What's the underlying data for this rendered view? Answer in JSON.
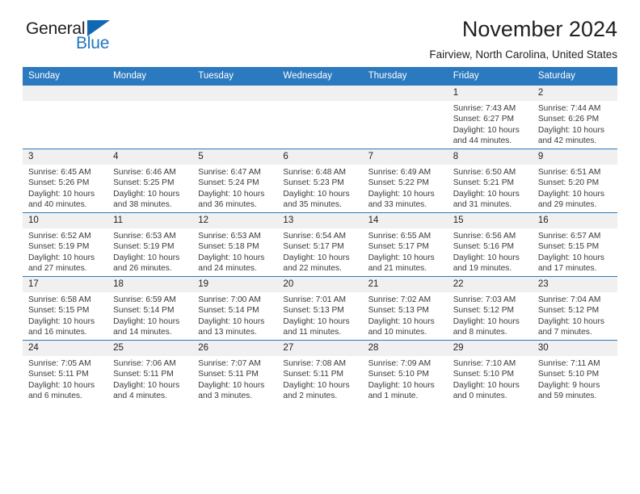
{
  "brand": {
    "name_part1": "General",
    "name_part2": "Blue",
    "triangle_icon": "triangle-icon",
    "accent_color": "#1068b3"
  },
  "header": {
    "month_title": "November 2024",
    "location": "Fairview, North Carolina, United States"
  },
  "calendar": {
    "header_bg": "#2b79bf",
    "daynum_bg": "#f0f0f0",
    "weekdays": [
      "Sunday",
      "Monday",
      "Tuesday",
      "Wednesday",
      "Thursday",
      "Friday",
      "Saturday"
    ],
    "weeks": [
      [
        {
          "day": "",
          "empty": true
        },
        {
          "day": "",
          "empty": true
        },
        {
          "day": "",
          "empty": true
        },
        {
          "day": "",
          "empty": true
        },
        {
          "day": "",
          "empty": true
        },
        {
          "day": "1",
          "sunrise": "Sunrise: 7:43 AM",
          "sunset": "Sunset: 6:27 PM",
          "daylight": "Daylight: 10 hours and 44 minutes."
        },
        {
          "day": "2",
          "sunrise": "Sunrise: 7:44 AM",
          "sunset": "Sunset: 6:26 PM",
          "daylight": "Daylight: 10 hours and 42 minutes."
        }
      ],
      [
        {
          "day": "3",
          "sunrise": "Sunrise: 6:45 AM",
          "sunset": "Sunset: 5:26 PM",
          "daylight": "Daylight: 10 hours and 40 minutes."
        },
        {
          "day": "4",
          "sunrise": "Sunrise: 6:46 AM",
          "sunset": "Sunset: 5:25 PM",
          "daylight": "Daylight: 10 hours and 38 minutes."
        },
        {
          "day": "5",
          "sunrise": "Sunrise: 6:47 AM",
          "sunset": "Sunset: 5:24 PM",
          "daylight": "Daylight: 10 hours and 36 minutes."
        },
        {
          "day": "6",
          "sunrise": "Sunrise: 6:48 AM",
          "sunset": "Sunset: 5:23 PM",
          "daylight": "Daylight: 10 hours and 35 minutes."
        },
        {
          "day": "7",
          "sunrise": "Sunrise: 6:49 AM",
          "sunset": "Sunset: 5:22 PM",
          "daylight": "Daylight: 10 hours and 33 minutes."
        },
        {
          "day": "8",
          "sunrise": "Sunrise: 6:50 AM",
          "sunset": "Sunset: 5:21 PM",
          "daylight": "Daylight: 10 hours and 31 minutes."
        },
        {
          "day": "9",
          "sunrise": "Sunrise: 6:51 AM",
          "sunset": "Sunset: 5:20 PM",
          "daylight": "Daylight: 10 hours and 29 minutes."
        }
      ],
      [
        {
          "day": "10",
          "sunrise": "Sunrise: 6:52 AM",
          "sunset": "Sunset: 5:19 PM",
          "daylight": "Daylight: 10 hours and 27 minutes."
        },
        {
          "day": "11",
          "sunrise": "Sunrise: 6:53 AM",
          "sunset": "Sunset: 5:19 PM",
          "daylight": "Daylight: 10 hours and 26 minutes."
        },
        {
          "day": "12",
          "sunrise": "Sunrise: 6:53 AM",
          "sunset": "Sunset: 5:18 PM",
          "daylight": "Daylight: 10 hours and 24 minutes."
        },
        {
          "day": "13",
          "sunrise": "Sunrise: 6:54 AM",
          "sunset": "Sunset: 5:17 PM",
          "daylight": "Daylight: 10 hours and 22 minutes."
        },
        {
          "day": "14",
          "sunrise": "Sunrise: 6:55 AM",
          "sunset": "Sunset: 5:17 PM",
          "daylight": "Daylight: 10 hours and 21 minutes."
        },
        {
          "day": "15",
          "sunrise": "Sunrise: 6:56 AM",
          "sunset": "Sunset: 5:16 PM",
          "daylight": "Daylight: 10 hours and 19 minutes."
        },
        {
          "day": "16",
          "sunrise": "Sunrise: 6:57 AM",
          "sunset": "Sunset: 5:15 PM",
          "daylight": "Daylight: 10 hours and 17 minutes."
        }
      ],
      [
        {
          "day": "17",
          "sunrise": "Sunrise: 6:58 AM",
          "sunset": "Sunset: 5:15 PM",
          "daylight": "Daylight: 10 hours and 16 minutes."
        },
        {
          "day": "18",
          "sunrise": "Sunrise: 6:59 AM",
          "sunset": "Sunset: 5:14 PM",
          "daylight": "Daylight: 10 hours and 14 minutes."
        },
        {
          "day": "19",
          "sunrise": "Sunrise: 7:00 AM",
          "sunset": "Sunset: 5:14 PM",
          "daylight": "Daylight: 10 hours and 13 minutes."
        },
        {
          "day": "20",
          "sunrise": "Sunrise: 7:01 AM",
          "sunset": "Sunset: 5:13 PM",
          "daylight": "Daylight: 10 hours and 11 minutes."
        },
        {
          "day": "21",
          "sunrise": "Sunrise: 7:02 AM",
          "sunset": "Sunset: 5:13 PM",
          "daylight": "Daylight: 10 hours and 10 minutes."
        },
        {
          "day": "22",
          "sunrise": "Sunrise: 7:03 AM",
          "sunset": "Sunset: 5:12 PM",
          "daylight": "Daylight: 10 hours and 8 minutes."
        },
        {
          "day": "23",
          "sunrise": "Sunrise: 7:04 AM",
          "sunset": "Sunset: 5:12 PM",
          "daylight": "Daylight: 10 hours and 7 minutes."
        }
      ],
      [
        {
          "day": "24",
          "sunrise": "Sunrise: 7:05 AM",
          "sunset": "Sunset: 5:11 PM",
          "daylight": "Daylight: 10 hours and 6 minutes."
        },
        {
          "day": "25",
          "sunrise": "Sunrise: 7:06 AM",
          "sunset": "Sunset: 5:11 PM",
          "daylight": "Daylight: 10 hours and 4 minutes."
        },
        {
          "day": "26",
          "sunrise": "Sunrise: 7:07 AM",
          "sunset": "Sunset: 5:11 PM",
          "daylight": "Daylight: 10 hours and 3 minutes."
        },
        {
          "day": "27",
          "sunrise": "Sunrise: 7:08 AM",
          "sunset": "Sunset: 5:11 PM",
          "daylight": "Daylight: 10 hours and 2 minutes."
        },
        {
          "day": "28",
          "sunrise": "Sunrise: 7:09 AM",
          "sunset": "Sunset: 5:10 PM",
          "daylight": "Daylight: 10 hours and 1 minute."
        },
        {
          "day": "29",
          "sunrise": "Sunrise: 7:10 AM",
          "sunset": "Sunset: 5:10 PM",
          "daylight": "Daylight: 10 hours and 0 minutes."
        },
        {
          "day": "30",
          "sunrise": "Sunrise: 7:11 AM",
          "sunset": "Sunset: 5:10 PM",
          "daylight": "Daylight: 9 hours and 59 minutes."
        }
      ]
    ]
  }
}
